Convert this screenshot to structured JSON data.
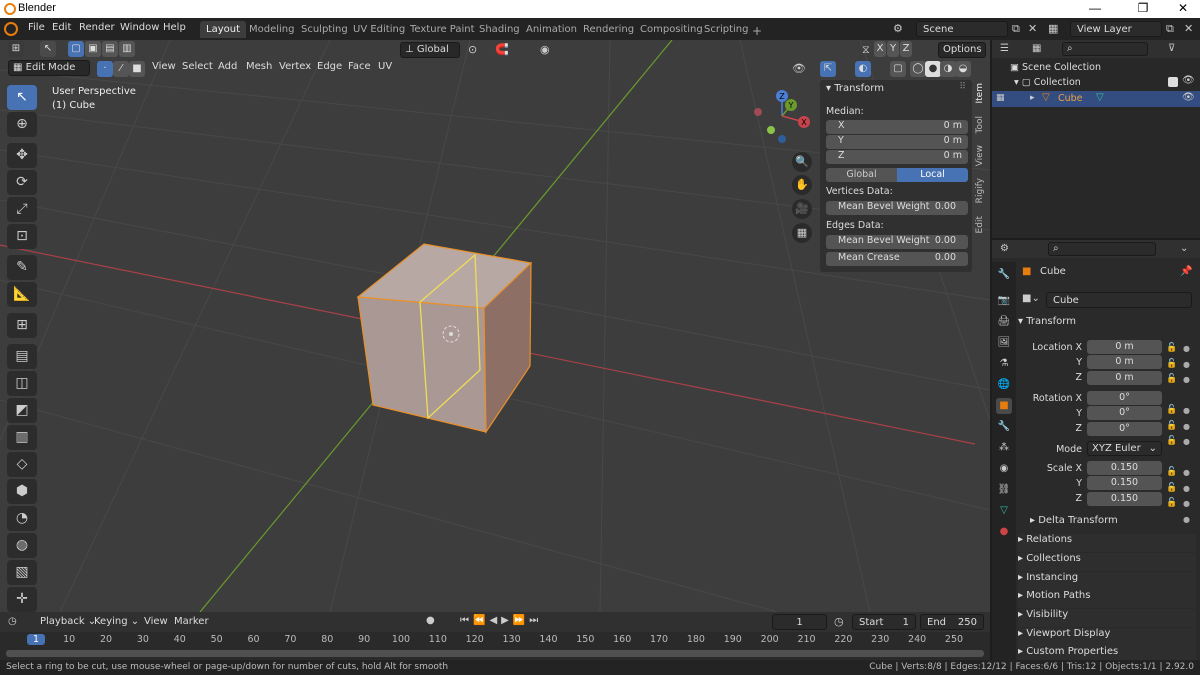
{
  "window": {
    "title": "Blender",
    "controls": [
      "—",
      "❐",
      "✕"
    ]
  },
  "menu": [
    "File",
    "Edit",
    "Render",
    "Window",
    "Help"
  ],
  "workspaces": [
    "Layout",
    "Modeling",
    "Sculpting",
    "UV Editing",
    "Texture Paint",
    "Shading",
    "Animation",
    "Rendering",
    "Compositing",
    "Scripting"
  ],
  "active_workspace": "Layout",
  "scene": {
    "label": "Scene",
    "view_layer": "View Layer"
  },
  "viewport_header": {
    "orientation": "Global",
    "options": "Options",
    "axes": [
      "X",
      "Y",
      "Z"
    ],
    "mode": "Edit Mode",
    "menus": [
      "View",
      "Select",
      "Add",
      "Mesh",
      "Vertex",
      "Edge",
      "Face",
      "UV"
    ]
  },
  "viewport": {
    "perspective": "User Perspective",
    "object": "(1) Cube"
  },
  "navigation_gizmo": {
    "x": "X",
    "y": "Y",
    "z": "Z"
  },
  "npanel": {
    "section": "Transform",
    "median_label": "Median:",
    "median": [
      {
        "axis": "X",
        "value": "0 m"
      },
      {
        "axis": "Y",
        "value": "0 m"
      },
      {
        "axis": "Z",
        "value": "0 m"
      }
    ],
    "global": "Global",
    "local": "Local",
    "vertices_label": "Vertices Data:",
    "vertex_bevel": {
      "label": "Mean Bevel Weight",
      "value": "0.00"
    },
    "edges_label": "Edges Data:",
    "edge_bevel": {
      "label": "Mean Bevel Weight",
      "value": "0.00"
    },
    "edge_crease": {
      "label": "Mean Crease",
      "value": "0.00"
    },
    "tabs": [
      "Item",
      "Tool",
      "View",
      "Rigify",
      "Edit"
    ]
  },
  "outliner": {
    "root": "Scene Collection",
    "collection": "Collection",
    "object": "Cube"
  },
  "properties": {
    "object_name": "Cube",
    "data_name": "Cube",
    "transform": "Transform",
    "location": {
      "label": "Location X",
      "values": [
        "0 m",
        "0 m",
        "0 m"
      ]
    },
    "rotation": {
      "label": "Rotation X",
      "values": [
        "0°",
        "0°",
        "0°"
      ]
    },
    "mode": {
      "label": "Mode",
      "value": "XYZ Euler"
    },
    "scale": {
      "label": "Scale X",
      "values": [
        "0.150",
        "0.150",
        "0.150"
      ]
    },
    "yz": [
      "Y",
      "Z"
    ],
    "delta": "Delta Transform",
    "sections": [
      "Relations",
      "Collections",
      "Instancing",
      "Motion Paths",
      "Visibility",
      "Viewport Display",
      "Custom Properties"
    ]
  },
  "timeline": {
    "menus": [
      "Playback",
      "Keying",
      "View",
      "Marker"
    ],
    "current_frame": "1",
    "start_label": "Start",
    "start": "1",
    "end_label": "End",
    "end": "250",
    "ticks": [
      "1",
      "10",
      "20",
      "30",
      "40",
      "50",
      "60",
      "70",
      "80",
      "90",
      "100",
      "110",
      "120",
      "130",
      "140",
      "150",
      "160",
      "170",
      "180",
      "190",
      "200",
      "210",
      "220",
      "230",
      "240",
      "250"
    ]
  },
  "status": {
    "hint": "Select a ring to be cut, use mouse-wheel or page-up/down for number of cuts, hold Alt for smooth",
    "stats": "Cube | Verts:8/8 | Edges:12/12 | Faces:6/6 | Tris:12 | Objects:1/1 | 2.92.0"
  },
  "colors": {
    "accent": "#4772b3",
    "selection": "#e87d0d",
    "axis_x": "#c8444d",
    "axis_y": "#6a9a2b"
  }
}
